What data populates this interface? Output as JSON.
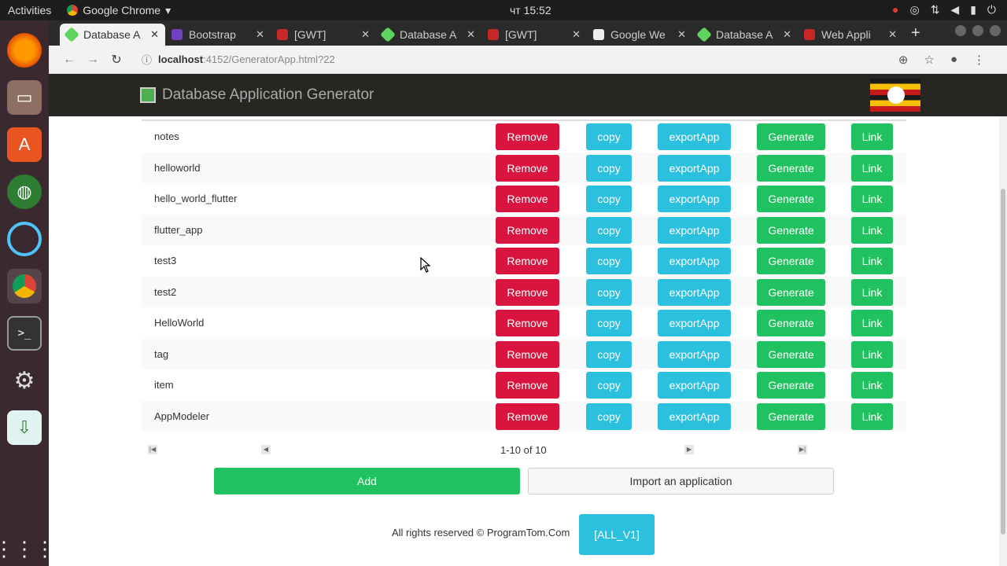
{
  "system": {
    "activities": "Activities",
    "app_name": "Google Chrome",
    "clock": "чт 15:52"
  },
  "tabs": [
    {
      "label": "Database A",
      "fav_color": "#5fd35f"
    },
    {
      "label": "Bootstrap",
      "fav_color": "#6f42c1"
    },
    {
      "label": "[GWT]",
      "fav_color": "#c62828"
    },
    {
      "label": "Database A",
      "fav_color": "#5fd35f"
    },
    {
      "label": "[GWT]",
      "fav_color": "#c62828"
    },
    {
      "label": "Google We",
      "fav_color": "#eeeeee"
    },
    {
      "label": "Database A",
      "fav_color": "#5fd35f"
    },
    {
      "label": "Web Appli",
      "fav_color": "#c62828"
    }
  ],
  "address": {
    "host": "localhost",
    "path": ":4152/GeneratorApp.html?22"
  },
  "app": {
    "title": "Database Application Generator"
  },
  "buttons": {
    "remove": "Remove",
    "copy": "copy",
    "export": "exportApp",
    "generate": "Generate",
    "link": "Link"
  },
  "rows": [
    {
      "name": "notes"
    },
    {
      "name": "helloworld"
    },
    {
      "name": "hello_world_flutter"
    },
    {
      "name": "flutter_app"
    },
    {
      "name": "test3"
    },
    {
      "name": "test2"
    },
    {
      "name": "HelloWorld"
    },
    {
      "name": "tag"
    },
    {
      "name": "item"
    },
    {
      "name": "AppModeler"
    }
  ],
  "pager": {
    "range": "1-10 of 10"
  },
  "actions": {
    "add": "Add",
    "import": "Import an application"
  },
  "footer": {
    "copyright": "All rights reserved © ProgramTom.Com",
    "version": "[ALL_V1]"
  }
}
